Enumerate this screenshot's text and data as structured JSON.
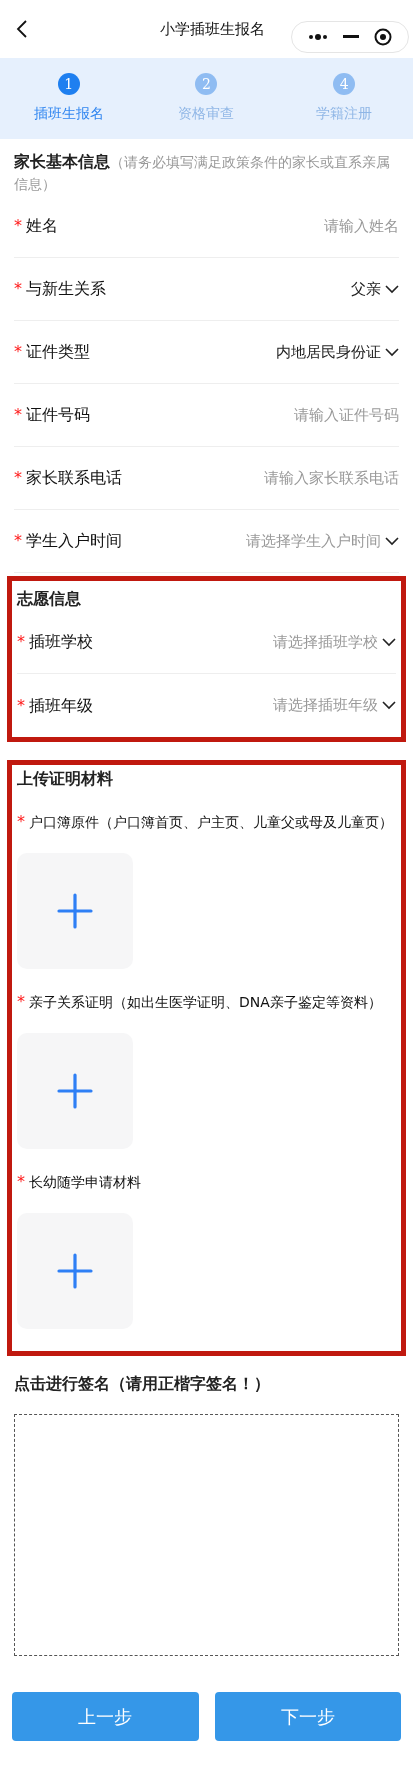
{
  "nav": {
    "title": "小学插班生报名"
  },
  "steps": [
    {
      "number": "1",
      "label": "插班生报名",
      "selected": true
    },
    {
      "number": "2",
      "label": "资格审查",
      "selected": false
    },
    {
      "number": "4",
      "label": "学籍注册",
      "selected": false
    }
  ],
  "parent_section": {
    "title": "家长基本信息",
    "note": "（请务必填写满足政策条件的家长或直系亲属信息）",
    "fields": [
      {
        "kind": "input",
        "mark": "*",
        "label": "姓名",
        "placeholder": "请输入姓名"
      },
      {
        "kind": "select",
        "mark": "*",
        "label": "与新生关系",
        "value": "父亲"
      },
      {
        "kind": "select",
        "mark": "*",
        "label": "证件类型",
        "value": "内地居民身份证"
      },
      {
        "kind": "input",
        "mark": "*",
        "label": "证件号码",
        "placeholder": "请输入证件号码"
      },
      {
        "kind": "input",
        "mark": "*",
        "label": "家长联系电话",
        "placeholder": "请输入家长联系电话"
      },
      {
        "kind": "select",
        "mark": "*",
        "label": "学生入户时间",
        "placeholder": "请选择学生入户时间"
      }
    ]
  },
  "wish_section": {
    "title": "志愿信息",
    "highlighted": true,
    "fields": [
      {
        "kind": "select",
        "mark": "*",
        "label": "插班学校",
        "placeholder": "请选择插班学校"
      },
      {
        "kind": "select",
        "mark": "*",
        "label": "插班年级",
        "placeholder": "请选择插班年级"
      }
    ]
  },
  "upload_section": {
    "title": "上传证明材料",
    "highlighted": true,
    "items": [
      {
        "mark": "*",
        "label": "户口簿原件（户口簿首页、户主页、儿童父或母及儿童页）"
      },
      {
        "mark": "*",
        "label": "亲子关系证明（如出生医学证明、DNA亲子鉴定等资料）"
      },
      {
        "mark": "*",
        "label": "长幼随学申请材料"
      }
    ]
  },
  "signature": {
    "title": "点击进行签名（请用正楷字签名！）"
  },
  "buttons": [
    {
      "label": "上一步"
    },
    {
      "label": "下一步"
    }
  ]
}
